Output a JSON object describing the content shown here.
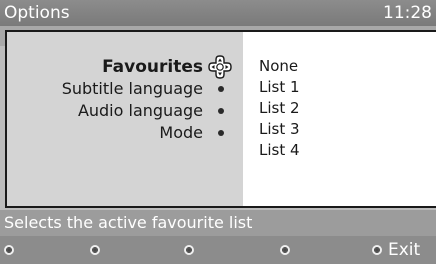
{
  "header": {
    "title": "Options",
    "time": "11:28"
  },
  "menu": {
    "items": [
      {
        "label": "Favourites",
        "active": true
      },
      {
        "label": "Subtitle language",
        "active": false
      },
      {
        "label": "Audio language",
        "active": false
      },
      {
        "label": "Mode",
        "active": false
      }
    ]
  },
  "options": {
    "items": [
      "None",
      "List 1",
      "List 2",
      "List 3",
      "List 4"
    ]
  },
  "hint": {
    "text": "Selects the active favourite list"
  },
  "footer": {
    "exit_label": "Exit"
  },
  "icons": {
    "nav": "navigation-cross-icon",
    "bullet": "bullet-icon",
    "color_key": "remote-color-key-icon"
  },
  "colors": {
    "title_bar": "#8c8c8c",
    "panel_left": "#d4d4d4",
    "panel_right": "#ffffff",
    "hint_bar": "#9c9c9c",
    "bottom_bar": "#8c8c8c"
  }
}
